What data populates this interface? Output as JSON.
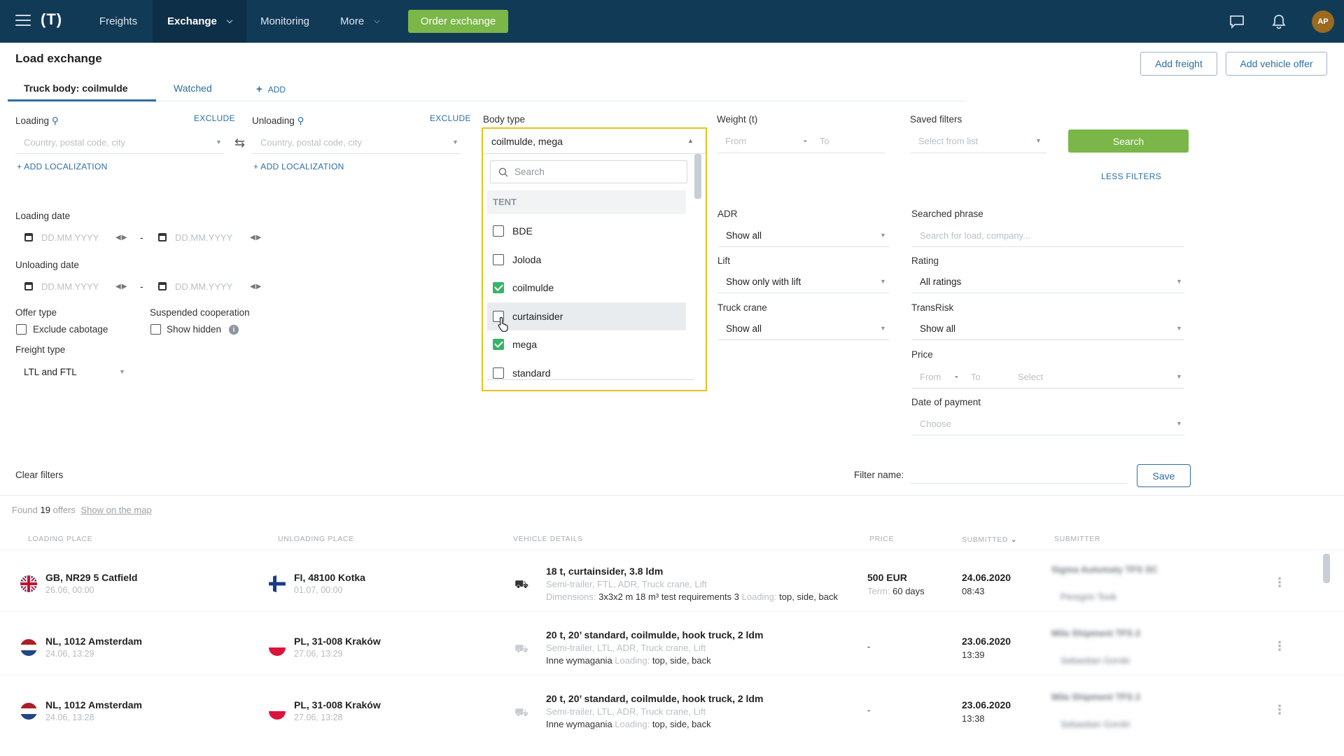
{
  "topbar": {
    "logo": "(T)",
    "nav": [
      {
        "label": "Freights"
      },
      {
        "label": "Exchange"
      },
      {
        "label": "Monitoring"
      },
      {
        "label": "More"
      }
    ],
    "order_button": "Order exchange",
    "avatar": "AP"
  },
  "header": {
    "title": "Load exchange",
    "add_freight": "Add freight",
    "add_vehicle_offer": "Add vehicle offer"
  },
  "tabs": {
    "active": "Truck body: coilmulde",
    "watched": "Watched",
    "add": "ADD"
  },
  "filters": {
    "loading_label": "Loading",
    "unloading_label": "Unloading",
    "exclude": "EXCLUDE",
    "place_placeholder": "Country, postal code, city",
    "add_localization": "+ ADD LOCALIZATION",
    "loading_date": "Loading date",
    "unloading_date": "Unloading date",
    "date_placeholder": "DD.MM.YYYY",
    "offer_type": "Offer type",
    "exclude_cabotage": "Exclude cabotage",
    "suspended_cooperation": "Suspended cooperation",
    "show_hidden": "Show hidden",
    "freight_type": "Freight type",
    "freight_type_value": "LTL and FTL",
    "body_type": "Body type",
    "weight": "Weight (t)",
    "from": "From",
    "to": "To",
    "saved_filters": "Saved filters",
    "select_from_list": "Select from list",
    "search_button": "Search",
    "less_filters": "LESS FILTERS",
    "adr": "ADR",
    "adr_value": "Show all",
    "lift": "Lift",
    "lift_value": "Show only with lift",
    "truck_crane": "Truck crane",
    "truck_crane_value": "Show all",
    "searched_phrase": "Searched phrase",
    "searched_placeholder": "Search for load, company...",
    "rating": "Rating",
    "rating_value": "All ratings",
    "transrisk": "TransRisk",
    "transrisk_value": "Show all",
    "price": "Price",
    "price_select": "Select",
    "date_of_payment": "Date of payment",
    "choose": "Choose",
    "clear_filters": "Clear filters",
    "filter_name": "Filter name:",
    "save": "Save"
  },
  "body_type_dropdown": {
    "value": "coilmulde, mega",
    "search_placeholder": "Search",
    "group": "TENT",
    "options": [
      {
        "label": "BDE",
        "checked": false
      },
      {
        "label": "Joloda",
        "checked": false
      },
      {
        "label": "coilmulde",
        "checked": true
      },
      {
        "label": "curtainsider",
        "checked": false
      },
      {
        "label": "mega",
        "checked": true
      },
      {
        "label": "standard",
        "checked": false
      }
    ]
  },
  "results": {
    "found_prefix": "Found",
    "found_count": "19",
    "found_suffix": "offers",
    "show_on_map": "Show on the map",
    "columns": [
      "LOADING PLACE",
      "UNLOADING PLACE",
      "VEHICLE DETAILS",
      "PRICE",
      "SUBMITTED",
      "SUBMITTER"
    ],
    "rows": [
      {
        "loading": "GB, NR29 5 Catfield",
        "loading_date": "26.06, 00:00",
        "unloading": "FI, 48100 Kotka",
        "unloading_date": "01.07, 00:00",
        "vehicle": "18 t, curtainsider, 3.8 ldm",
        "vehicle_sub": "Semi-trailer, FTL, ADR, Truck crane, Lift",
        "dimensions_label": "Dimensions:",
        "dimensions": "3x3x2 m 18 m³ test requirements 3",
        "loading_label": "Loading:",
        "loading_sides": "top, side, back",
        "price": "500 EUR",
        "term_label": "Term:",
        "term": "60 days",
        "submitted_date": "24.06.2020",
        "submitted_time": "08:43",
        "submitter": "Sigma Automaty TFS SC",
        "person": "Peregrin Took"
      },
      {
        "loading": "NL, 1012 Amsterdam",
        "loading_date": "24.06, 13:29",
        "unloading": "PL, 31-008 Kraków",
        "unloading_date": "27.06, 13:29",
        "vehicle": "20 t, 20’ standard, coilmulde, hook truck, 2 ldm",
        "vehicle_sub": "Semi-trailer, LTL, ADR, Truck crane, Lift",
        "extra": "Inne wymagania",
        "loading_label": "Loading:",
        "loading_sides": "top, side, back",
        "price": "-",
        "submitted_date": "23.06.2020",
        "submitted_time": "13:39",
        "submitter": "Mila Shipment TFS 2",
        "person": "Sebastian Gorski"
      },
      {
        "loading": "NL, 1012 Amsterdam",
        "loading_date": "24.06, 13:28",
        "unloading": "PL, 31-008 Kraków",
        "unloading_date": "27.06, 13:28",
        "vehicle": "20 t, 20’ standard, coilmulde, hook truck, 2 ldm",
        "vehicle_sub": "Semi-trailer, LTL, ADR, Truck crane, Lift",
        "extra": "Inne wymagania",
        "loading_label": "Loading:",
        "loading_sides": "top, side, back",
        "price": "-",
        "submitted_date": "23.06.2020",
        "submitted_time": "13:38",
        "submitter": "Mila Shipment TFS 2",
        "person": "Sebastian Gorski"
      }
    ]
  },
  "colors": {
    "topbar": "#113a57",
    "accent_green": "#7ab648",
    "link_blue": "#2c6ea3",
    "dropdown_border": "#e7c31a",
    "check_green": "#38b36a"
  }
}
